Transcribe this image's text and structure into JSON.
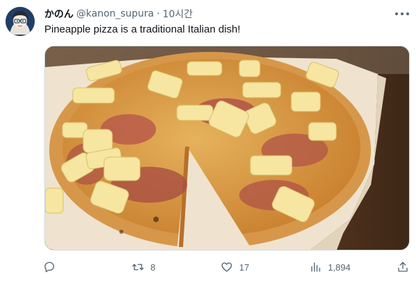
{
  "tweet": {
    "author": {
      "display_name": "かのん",
      "handle": "@kanon_supura",
      "separator": "·",
      "time": "10시간",
      "avatar_icon": "anime-character-avatar"
    },
    "text": "Pineapple pizza is a traditional Italian dish!",
    "media": {
      "type": "photo",
      "subject": "pineapple-ham-pizza"
    },
    "actions": {
      "reply": {
        "icon": "reply-icon",
        "count": ""
      },
      "retweet": {
        "icon": "retweet-icon",
        "count": "8"
      },
      "like": {
        "icon": "heart-icon",
        "count": "17"
      },
      "views": {
        "icon": "views-chart-icon",
        "count": "1,894"
      },
      "share": {
        "icon": "share-icon"
      }
    },
    "more_icon": "more-dots-icon"
  },
  "colors": {
    "text_primary": "#0f1419",
    "text_secondary": "#536471",
    "border": "#cfd9de"
  }
}
